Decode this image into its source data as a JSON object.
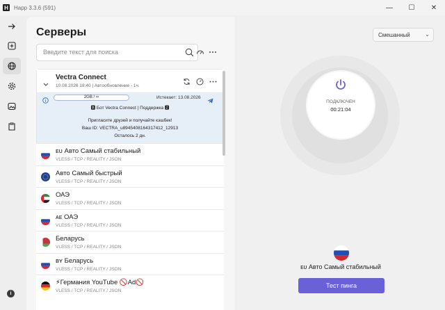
{
  "window": {
    "app_icon": "H",
    "title": "Happ 3.3.6 (591)",
    "minimize": "—",
    "maximize": "☐",
    "close": "✕"
  },
  "rail": [
    {
      "icon": "arrow-right-icon"
    },
    {
      "icon": "plus-square-icon"
    },
    {
      "icon": "globe-icon",
      "active": true
    },
    {
      "icon": "gear-icon"
    },
    {
      "icon": "image-icon"
    },
    {
      "icon": "clipboard-icon"
    }
  ],
  "servers": {
    "title": "Серверы",
    "search_placeholder": "Введите текст для поиска",
    "subscription": {
      "name": "Vectra Connect",
      "meta": "10.08.2026 18:40 | Автообновление - 1ч.",
      "traffic": "2GB / ∞",
      "expires": "Истекает: 13.08.2026",
      "links": "🅱 Бот Vectra Connect | Поддержка 🆉",
      "invite": "Пригласите друзей и получайте кэшбек!",
      "user_id": "Ваш ID: VECTRA_u8945408164317412_12913",
      "remaining": "Осталось 2 дн."
    },
    "items": [
      {
        "name": "ᴇᴜ Авто Самый стабильный",
        "protocol": "VLESS / TCP / REALITY / JSON",
        "flag": "ru"
      },
      {
        "name": "Авто Самый быстрый",
        "protocol": "VLESS / TCP / REALITY / JSON",
        "flag": "eu"
      },
      {
        "name": "ОАЭ",
        "protocol": "VLESS / TCP / REALITY / JSON",
        "flag": "ae"
      },
      {
        "name": "ᴀᴇ ОАЭ",
        "protocol": "VLESS / TCP / REALITY / JSON",
        "flag": "ru"
      },
      {
        "name": "Беларусь",
        "protocol": "VLESS / TCP / REALITY / JSON",
        "flag": "by"
      },
      {
        "name": "ʙʏ Беларусь",
        "protocol": "VLESS / TCP / REALITY / JSON",
        "flag": "ru"
      },
      {
        "name": "⚡Германия YouTube 🚫Ad🚫",
        "protocol": "VLESS / TCP / REALITY / JSON",
        "flag": "de"
      }
    ]
  },
  "connection": {
    "mode": "Смешанный",
    "status": "ПОДКЛЮЧЕН",
    "timer": "00:21:04",
    "selected_server": "ᴇᴜ Авто Самый стабильный",
    "ping_button": "Тест пинга"
  },
  "colors": {
    "accent": "#6a60d8",
    "icon_blue": "#2f6fd6",
    "ru_white": "#ffffff",
    "ru_blue": "#1f4fb4",
    "ru_red": "#d7262e"
  }
}
